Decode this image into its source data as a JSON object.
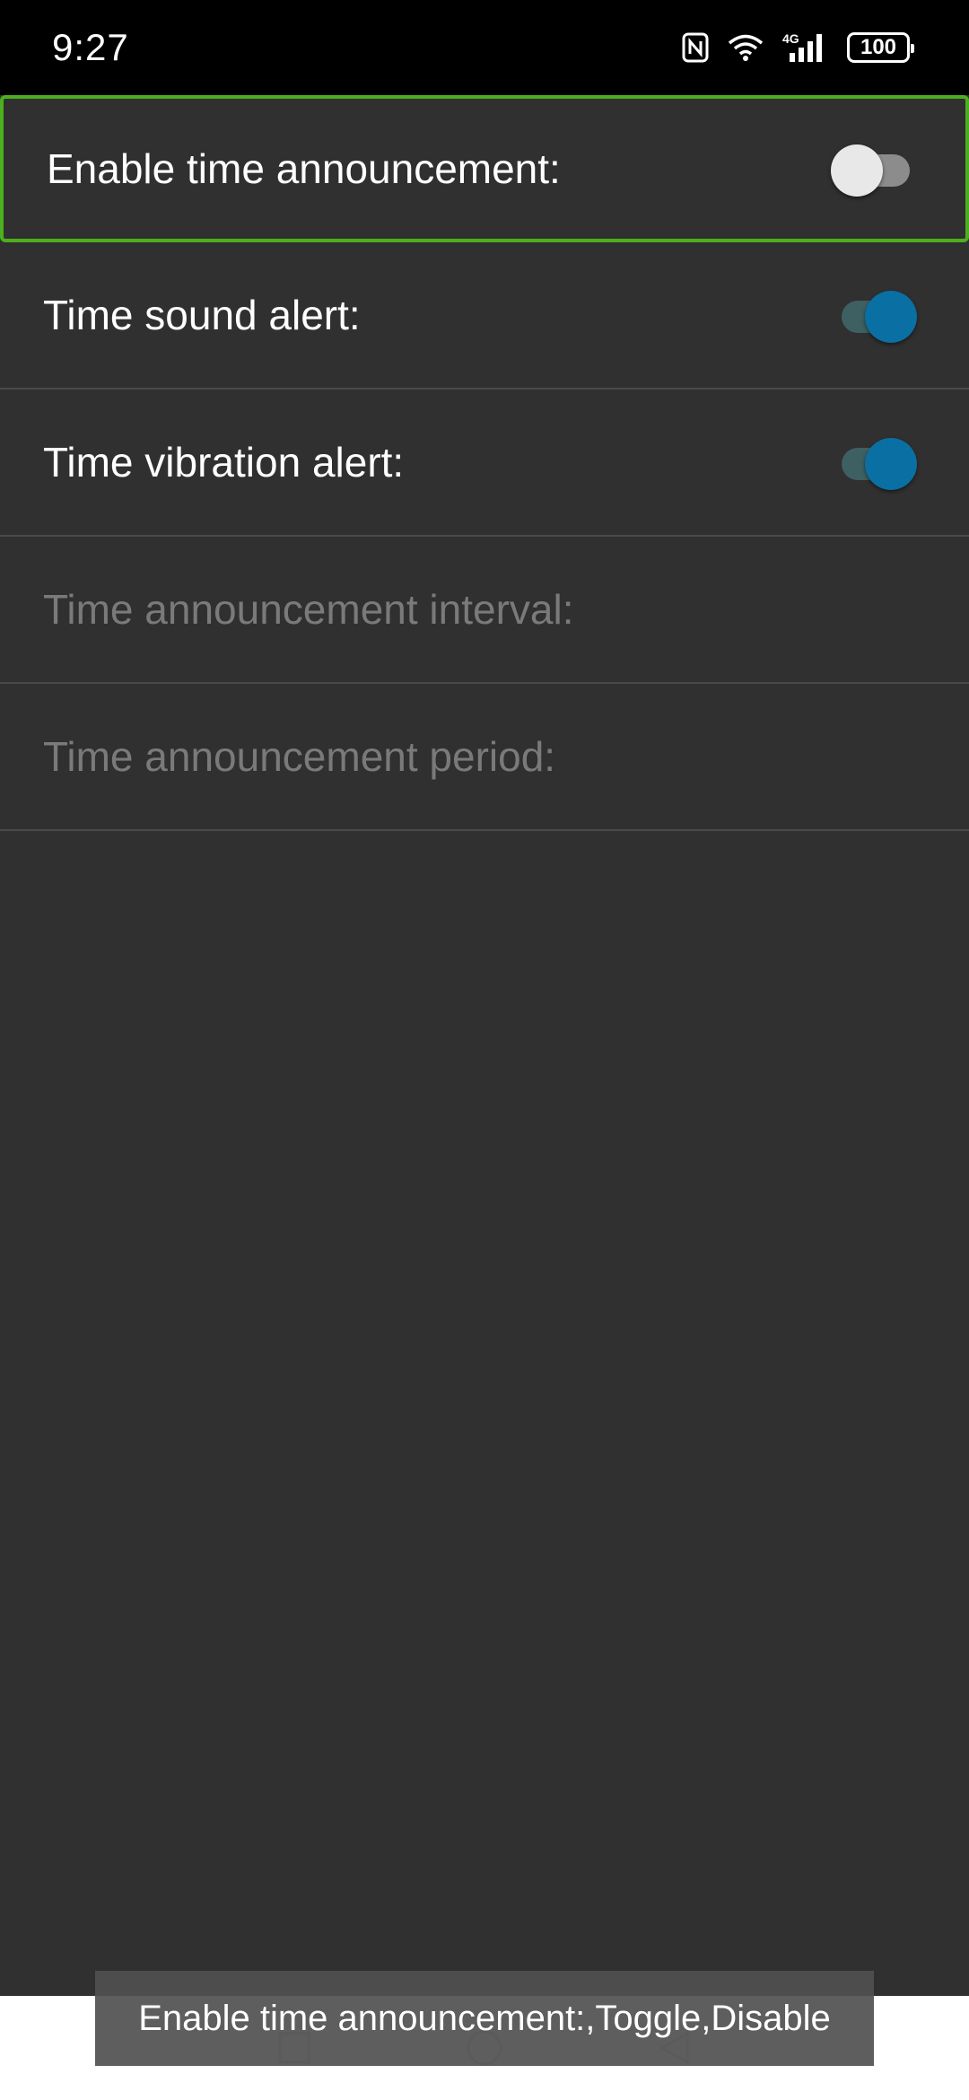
{
  "status_bar": {
    "time": "9:27",
    "battery": "100",
    "icons": [
      "nfc-icon",
      "wifi-icon",
      "4g-signal-icon",
      "battery-icon"
    ]
  },
  "settings": [
    {
      "label": "Enable time announcement:",
      "toggle": "off",
      "enabled": true
    },
    {
      "label": "Time sound alert:",
      "toggle": "on",
      "enabled": true
    },
    {
      "label": "Time vibration alert:",
      "toggle": "on",
      "enabled": true
    },
    {
      "label": "Time announcement interval:",
      "enabled": false
    },
    {
      "label": "Time announcement period:",
      "enabled": false
    }
  ],
  "toast": "Enable time announcement:,Toggle,Disable",
  "colors": {
    "background": "#303030",
    "focus_border": "#4caf1e",
    "toggle_on_thumb": "#0a6fa3",
    "toggle_on_track": "#3e6063",
    "disabled_text": "#7a7a7a"
  }
}
